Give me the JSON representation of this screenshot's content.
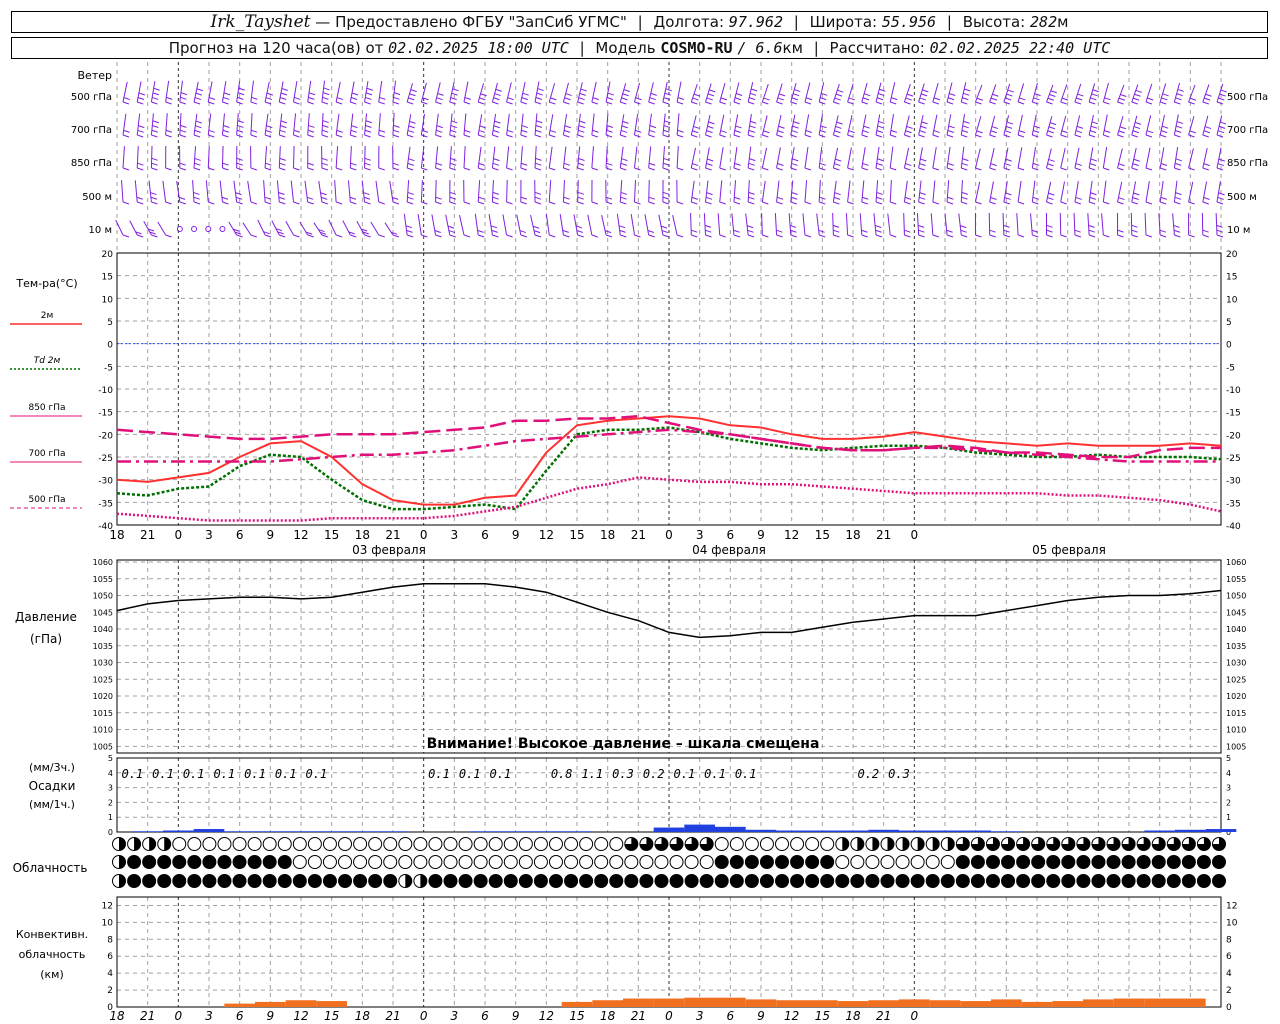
{
  "header": {
    "station": "Irk_Tayshet",
    "provider": "— Предоставлено ФГБУ \"ЗапСиб УГМС\"",
    "lon_label": "Долгота:",
    "lon_value": "97.962",
    "lat_label": "Широта:",
    "lat_value": "55.956",
    "alt_label": "Высота:",
    "alt_value": "282",
    "alt_unit": "м",
    "forecast_label": "Прогноз на 120 часа(ов) от",
    "forecast_start": "02.02.2025 18:00 UTC",
    "model_label": "Модель",
    "model_name": "COSMO-RU",
    "model_res": "/ 6.6",
    "model_res_unit": "км",
    "computed_label": "Рассчитано:",
    "computed_value": "02.02.2025 22:40 UTC"
  },
  "colors": {
    "t2m": "#ff3030",
    "td2m": "#007000",
    "t850": "#e0107a",
    "t700": "#e0107a",
    "t500": "#e0107a",
    "wind": "#8020e0",
    "pressure": "#000000",
    "precip": "#2040e0",
    "conv": "#f07020",
    "zero_line": "#3050ff",
    "grid": "#a0a0a0"
  },
  "wind": {
    "title": "Ветер",
    "levels": [
      "500 гПа",
      "700 гПа",
      "850 гПа",
      "500 м",
      "10  м"
    ],
    "levels_right": [
      "500 гПа",
      "700 гПа",
      "850 гПа",
      "500 м",
      "10  м"
    ]
  },
  "temp": {
    "title": "Тем-ра(°C)",
    "legend": [
      {
        "label": "2м",
        "style": "solid"
      },
      {
        "label": "Td  2м",
        "style": "dotted"
      },
      {
        "label": "850 гПа",
        "style": "solid"
      },
      {
        "label": "700 гПа",
        "style": "dashdot"
      },
      {
        "label": "500 гПа",
        "style": "dashed"
      }
    ],
    "ticks": [
      20,
      15,
      10,
      5,
      0,
      -5,
      -10,
      -15,
      -20,
      -25,
      -30,
      -35,
      -40
    ]
  },
  "time_axis": {
    "hours": [
      "18",
      "21",
      "0",
      "3",
      "6",
      "9",
      "12",
      "15",
      "18",
      "21",
      "0",
      "3",
      "6",
      "9",
      "12",
      "15",
      "18",
      "21",
      "0",
      "3",
      "6",
      "9",
      "12",
      "15",
      "18",
      "21",
      "0"
    ],
    "dates": [
      "03 февраля",
      "04 февраля",
      "05 февраля"
    ]
  },
  "pressure": {
    "title_1": "Давление",
    "title_2": "(гПа)",
    "ticks": [
      1060,
      1055,
      1050,
      1045,
      1040,
      1035,
      1030,
      1025,
      1020,
      1015,
      1010,
      1005
    ],
    "warning": "Внимание! Высокое давление – шкала смещена"
  },
  "precip": {
    "unit_3h": "(мм/3ч.)",
    "title": "Осадки",
    "unit_1h": "(мм/1ч.)",
    "ticks": [
      5,
      4,
      3,
      2,
      1,
      0
    ],
    "labels_3h": [
      "0.1",
      "0.1",
      "0.1",
      "0.1",
      "0.1",
      "0.1",
      "0.1",
      "",
      "",
      "",
      "0.1",
      "0.1",
      "0.1",
      "",
      "0.8",
      "1.1",
      "0.3",
      "0.2",
      "0.1",
      "0.1",
      "0.1",
      "",
      "",
      "",
      "0.2",
      "0.3"
    ]
  },
  "cloud": {
    "title": "Облачность"
  },
  "conv": {
    "title_1": "Конвективн.",
    "title_2": "облачность",
    "title_3": "(км)",
    "ticks": [
      12,
      10,
      8,
      6,
      4,
      2,
      0
    ]
  },
  "chart_data": [
    {
      "type": "line",
      "title": "Тем-ра(°C)",
      "x_hours_from_start": [
        0,
        3,
        6,
        9,
        12,
        15,
        18,
        21,
        24,
        27,
        30,
        33,
        36,
        39,
        42,
        45,
        48,
        51,
        54,
        57,
        60,
        63,
        66,
        69,
        72,
        75,
        78,
        81,
        84,
        87,
        90,
        93,
        96,
        99,
        102,
        105,
        108
      ],
      "x_tick_labels": [
        "18",
        "21",
        "0",
        "3",
        "6",
        "9",
        "12",
        "15",
        "18",
        "21",
        "0",
        "3",
        "6",
        "9",
        "12",
        "15",
        "18",
        "21",
        "0",
        "3",
        "6",
        "9",
        "12",
        "15",
        "18",
        "21",
        "0"
      ],
      "ylim": [
        -40,
        20
      ],
      "series": [
        {
          "name": "2м",
          "values": [
            -30,
            -30.5,
            -29.5,
            -28.5,
            -25,
            -22,
            -21.5,
            -25,
            -31,
            -34.5,
            -35.5,
            -35.5,
            -34,
            -33.5,
            -24,
            -18,
            -17,
            -16.5,
            -16,
            -16.5,
            -18,
            -18.5,
            -20,
            -21,
            -21,
            -20.5,
            -19.5,
            -20.5,
            -21.5,
            -22,
            -22.5,
            -22,
            -22.5,
            -22.5,
            -22.5,
            -22,
            -22.5
          ]
        },
        {
          "name": "Td  2м",
          "values": [
            -33,
            -33.5,
            -32,
            -31.5,
            -27,
            -24.5,
            -25,
            -30,
            -34.5,
            -36.5,
            -36.5,
            -36,
            -35.5,
            -36.5,
            -28,
            -20,
            -19,
            -19,
            -18.5,
            -19.5,
            -21,
            -22,
            -23,
            -23.5,
            -23,
            -22.5,
            -22.5,
            -23,
            -24,
            -24.5,
            -25,
            -25,
            -24.5,
            -25,
            -25,
            -25,
            -25.5
          ]
        },
        {
          "name": "850 гПа",
          "values": [
            -19,
            -19.5,
            -20,
            -20.5,
            -21,
            -21,
            -20.5,
            -20,
            -20,
            -20,
            -19.5,
            -19,
            -18.5,
            -17,
            -17,
            -16.5,
            -16.5,
            -16,
            -17.5,
            -19,
            -20,
            -21,
            -22,
            -23,
            -23.5,
            -23.5,
            -23,
            -22.5,
            -23,
            -24,
            -24,
            -24.5,
            -25,
            -25,
            -23.5,
            -23,
            -23
          ]
        },
        {
          "name": "700 гПа",
          "values": [
            -26,
            -26,
            -26,
            -26,
            -26,
            -26,
            -25.5,
            -25,
            -24.5,
            -24.5,
            -24,
            -23.5,
            -22.5,
            -21.5,
            -21,
            -20.5,
            -20,
            -19.5,
            -19,
            -19.5,
            -20,
            -21,
            -22,
            -23,
            -23.5,
            -23.5,
            -23,
            -23,
            -23.5,
            -24,
            -24.5,
            -25,
            -25.5,
            -26,
            -26,
            -26,
            -26
          ]
        },
        {
          "name": "500 гПа",
          "values": [
            -37.5,
            -38,
            -38.5,
            -39,
            -39,
            -39,
            -39,
            -38.5,
            -38.5,
            -38.5,
            -38.5,
            -38,
            -37,
            -36,
            -34,
            -32,
            -31,
            -29.5,
            -30,
            -30.5,
            -30.5,
            -31,
            -31,
            -31.5,
            -32,
            -32.5,
            -33,
            -33,
            -33,
            -33,
            -33,
            -33.5,
            -33.5,
            -34,
            -34.5,
            -35.5,
            -37
          ]
        }
      ]
    },
    {
      "type": "line",
      "title": "Давление",
      "ylabel": "(гПа)",
      "x_hours_from_start": [
        0,
        3,
        6,
        9,
        12,
        15,
        18,
        21,
        24,
        27,
        30,
        33,
        36,
        39,
        42,
        45,
        48,
        51,
        54,
        57,
        60,
        63,
        66,
        69,
        72,
        75,
        78,
        81,
        84,
        87,
        90,
        93,
        96,
        99,
        102,
        105,
        108
      ],
      "ylim": [
        1005,
        1060
      ],
      "series": [
        {
          "name": "Давление",
          "values": [
            1045.5,
            1047.5,
            1048.5,
            1049,
            1049.5,
            1049.5,
            1049,
            1049.5,
            1051,
            1052.5,
            1053.5,
            1053.5,
            1053.5,
            1052.5,
            1051,
            1048,
            1045,
            1042.5,
            1039,
            1037.5,
            1038,
            1039,
            1039,
            1040.5,
            1042,
            1043,
            1044,
            1044,
            1044,
            1045.5,
            1047,
            1048.5,
            1049.5,
            1050,
            1050,
            1050.5,
            1051.5
          ]
        }
      ]
    },
    {
      "type": "bar",
      "title": "Осадки",
      "ylabel": "(мм/1ч.)",
      "x_hours_from_start": [
        0,
        3,
        6,
        9,
        12,
        15,
        18,
        21,
        24,
        27,
        30,
        33,
        36,
        39,
        42,
        45,
        48,
        51,
        54,
        57,
        60,
        63,
        66,
        69,
        72,
        75,
        78,
        81,
        84,
        87,
        90,
        93,
        96,
        99,
        102,
        105,
        108
      ],
      "ylim": [
        0,
        5
      ],
      "values": [
        0,
        0.05,
        0.1,
        0.2,
        0.05,
        0.05,
        0.05,
        0.05,
        0.05,
        0.05,
        0,
        0,
        0.05,
        0.05,
        0.05,
        0.05,
        0,
        0,
        0.3,
        0.5,
        0.35,
        0.15,
        0.1,
        0.1,
        0.1,
        0.15,
        0.1,
        0.1,
        0.1,
        0.05,
        0,
        0,
        0,
        0,
        0.1,
        0.15,
        0.2
      ]
    },
    {
      "type": "bar",
      "title": "Конвективн. облачность",
      "ylabel": "(км)",
      "x_hours_from_start": [
        0,
        3,
        6,
        9,
        12,
        15,
        18,
        21,
        24,
        27,
        30,
        33,
        36,
        39,
        42,
        45,
        48,
        51,
        54,
        57,
        60,
        63,
        66,
        69,
        72,
        75,
        78,
        81,
        84,
        87,
        90,
        93,
        96,
        99,
        102,
        105,
        108
      ],
      "ylim": [
        0,
        13
      ],
      "values": [
        0,
        0,
        0,
        0,
        0.4,
        0.6,
        0.8,
        0.7,
        0,
        0,
        0,
        0,
        0,
        0,
        0,
        0.6,
        0.8,
        1.0,
        1.0,
        1.1,
        1.1,
        0.9,
        0.8,
        0.8,
        0.7,
        0.8,
        0.9,
        0.8,
        0.7,
        0.9,
        0.6,
        0.7,
        0.9,
        1.0,
        1.0,
        1.0,
        0
      ]
    }
  ]
}
